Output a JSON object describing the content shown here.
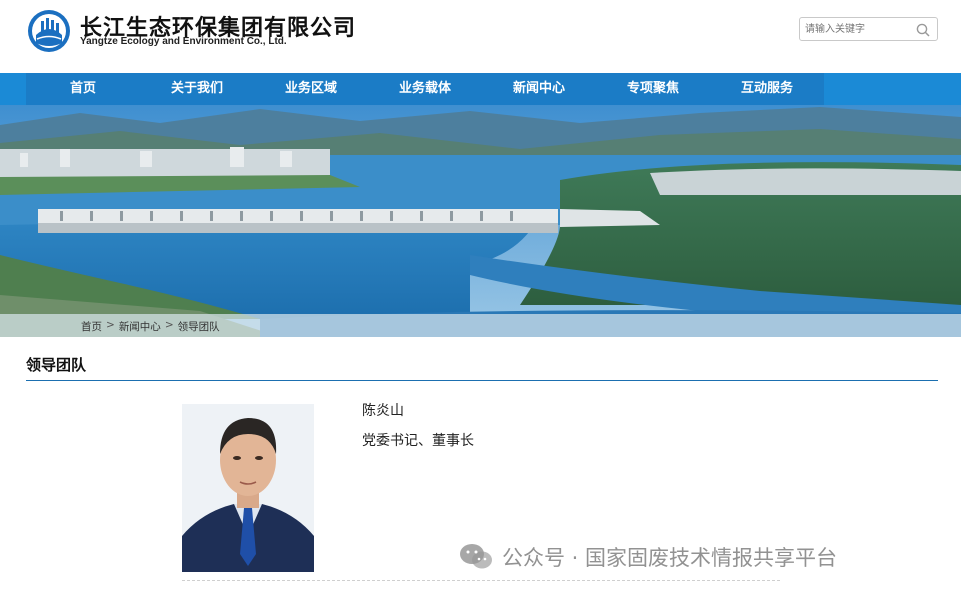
{
  "header": {
    "brand_cn": "长江生态环保集团有限公司",
    "brand_en": "Yangtze Ecology and Environment Co., Ltd.",
    "search_placeholder": "请输入关键字"
  },
  "nav": {
    "items": [
      {
        "label": "首页"
      },
      {
        "label": "关于我们"
      },
      {
        "label": "业务区域"
      },
      {
        "label": "业务载体"
      },
      {
        "label": "新闻中心"
      },
      {
        "label": "专项聚焦"
      },
      {
        "label": "互动服务"
      }
    ]
  },
  "breadcrumb": {
    "items": [
      "首页",
      "新闻中心",
      "领导团队"
    ],
    "separator": ">"
  },
  "section": {
    "title": "领导团队"
  },
  "leader": {
    "name": "陈炎山",
    "title": "党委书记、董事长"
  },
  "watermark": {
    "text": "公众号 · 国家固废技术情报共享平台"
  },
  "colors": {
    "nav_bg": "#1b8ad6",
    "nav_inner": "#1b7cc6",
    "rule": "#1b6fb0"
  }
}
